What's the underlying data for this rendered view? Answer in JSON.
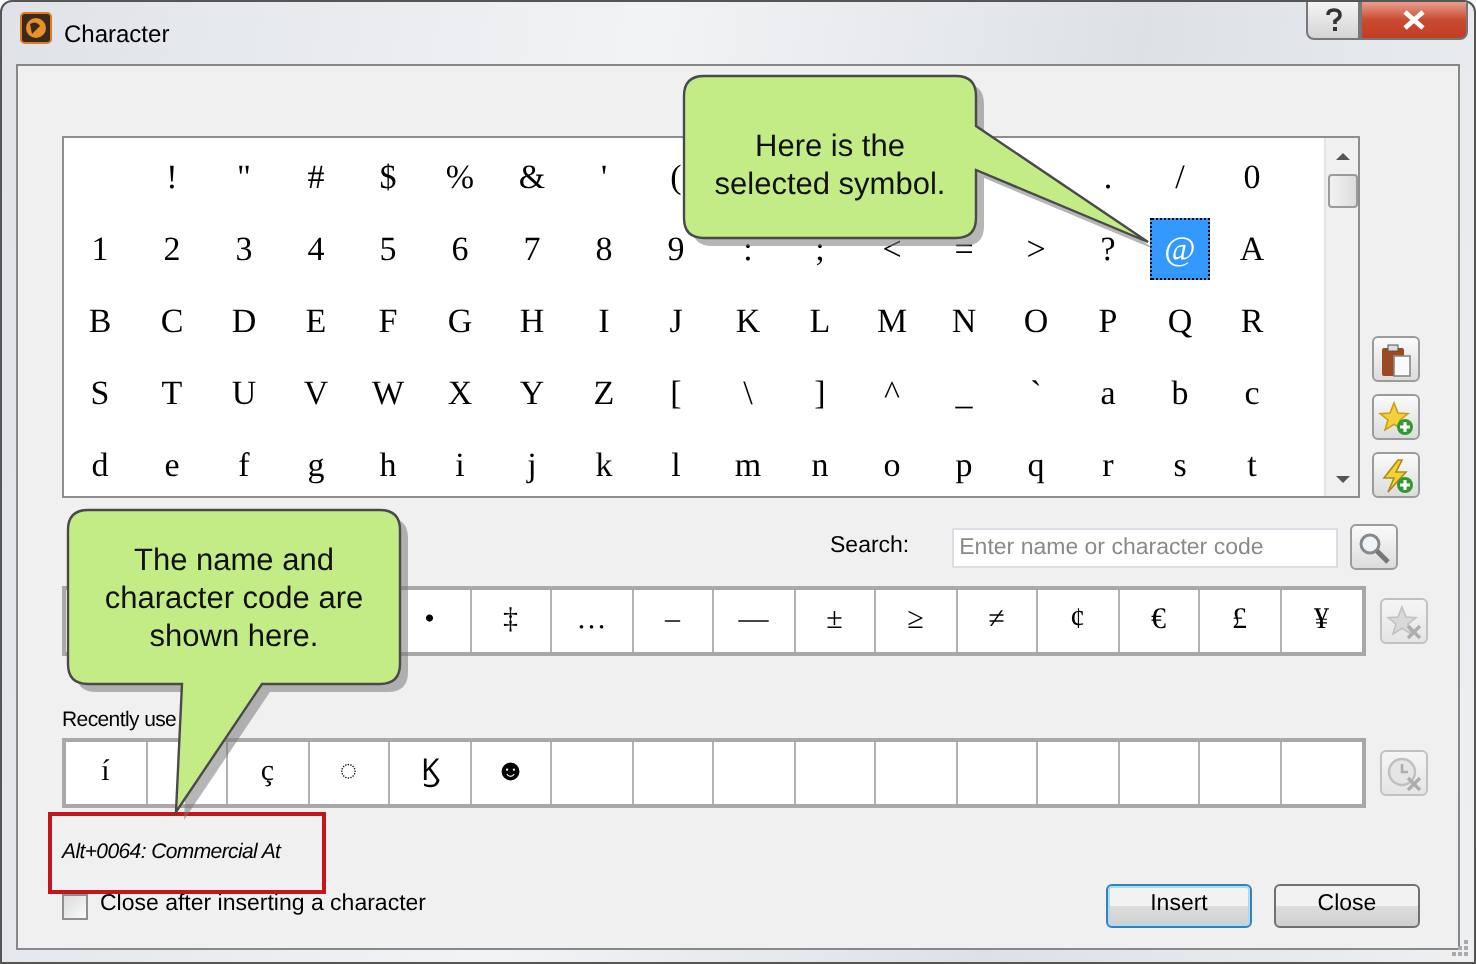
{
  "window": {
    "title": "Character"
  },
  "character_grid": {
    "rows": [
      [
        {
          "selected": false
        },
        {
          "char": "!",
          "selected": false
        },
        {
          "char": "\"",
          "selected": false
        },
        {
          "char": "#",
          "selected": false
        },
        {
          "char": "$",
          "selected": false
        },
        {
          "char": "%",
          "selected": false
        },
        {
          "char": "&",
          "selected": false
        },
        {
          "char": "'",
          "selected": false
        },
        {
          "char": "(",
          "selected": false
        },
        null,
        null,
        null,
        null,
        null,
        {
          "char": ".",
          "selected": false
        },
        {
          "char": "/",
          "selected": false
        },
        {
          "char": "0",
          "selected": false
        }
      ],
      [
        {
          "char": "1",
          "selected": false
        },
        {
          "char": "2",
          "selected": false
        },
        {
          "char": "3",
          "selected": false
        },
        {
          "char": "4",
          "selected": false
        },
        {
          "char": "5",
          "selected": false
        },
        {
          "char": "6",
          "selected": false
        },
        {
          "char": "7",
          "selected": false
        },
        {
          "char": "8",
          "selected": false
        },
        {
          "char": "9",
          "selected": false
        },
        {
          "char": ":",
          "selected": false
        },
        {
          "char": ";",
          "selected": false
        },
        {
          "char": "<",
          "selected": false
        },
        {
          "char": "=",
          "selected": false
        },
        {
          "char": ">",
          "selected": false
        },
        {
          "char": "?",
          "selected": false
        },
        {
          "char": "@",
          "selected": true
        },
        {
          "char": "A",
          "selected": false
        }
      ],
      [
        {
          "char": "B",
          "selected": false
        },
        {
          "char": "C",
          "selected": false
        },
        {
          "char": "D",
          "selected": false
        },
        {
          "char": "E",
          "selected": false
        },
        {
          "char": "F",
          "selected": false
        },
        {
          "char": "G",
          "selected": false
        },
        {
          "char": "H",
          "selected": false
        },
        {
          "char": "I",
          "selected": false
        },
        {
          "char": "J",
          "selected": false
        },
        {
          "char": "K",
          "selected": false
        },
        {
          "char": "L",
          "selected": false
        },
        {
          "char": "M",
          "selected": false
        },
        {
          "char": "N",
          "selected": false
        },
        {
          "char": "O",
          "selected": false
        },
        {
          "char": "P",
          "selected": false
        },
        {
          "char": "Q",
          "selected": false
        },
        {
          "char": "R",
          "selected": false
        }
      ],
      [
        {
          "char": "S",
          "selected": false
        },
        {
          "char": "T",
          "selected": false
        },
        {
          "char": "U",
          "selected": false
        },
        {
          "char": "V",
          "selected": false
        },
        {
          "char": "W",
          "selected": false
        },
        {
          "char": "X",
          "selected": false
        },
        {
          "char": "Y",
          "selected": false
        },
        {
          "char": "Z",
          "selected": false
        },
        {
          "char": "[",
          "selected": false
        },
        {
          "char": "\\",
          "selected": false
        },
        {
          "char": "]",
          "selected": false
        },
        {
          "char": "^",
          "selected": false
        },
        {
          "char": "_",
          "selected": false
        },
        {
          "char": "`",
          "selected": false
        },
        {
          "char": "a",
          "selected": false
        },
        {
          "char": "b",
          "selected": false
        },
        {
          "char": "c",
          "selected": false
        }
      ],
      [
        {
          "char": "d",
          "selected": false
        },
        {
          "char": "e",
          "selected": false
        },
        {
          "char": "f",
          "selected": false
        },
        {
          "char": "g",
          "selected": false
        },
        {
          "char": "h",
          "selected": false
        },
        {
          "char": "i",
          "selected": false
        },
        {
          "char": "j",
          "selected": false
        },
        {
          "char": "k",
          "selected": false
        },
        {
          "char": "l",
          "selected": false
        },
        {
          "char": "m",
          "selected": false
        },
        {
          "char": "n",
          "selected": false
        },
        {
          "char": "o",
          "selected": false
        },
        {
          "char": "p",
          "selected": false
        },
        {
          "char": "q",
          "selected": false
        },
        {
          "char": "r",
          "selected": false
        },
        {
          "char": "s",
          "selected": false
        },
        {
          "char": "t",
          "selected": false
        }
      ]
    ]
  },
  "search": {
    "label": "Search:",
    "placeholder": "Enter name or character code"
  },
  "favorites": {
    "cells": [
      null,
      null,
      null,
      null,
      "•",
      "‡",
      "…",
      "–",
      "—",
      "±",
      "≥",
      "≠",
      "¢",
      "€",
      "£",
      "¥"
    ]
  },
  "recently_used": {
    "label": "Recently use",
    "cells": [
      "í",
      null,
      "ç",
      "◌",
      "Ϗ",
      "☻",
      null,
      null,
      null,
      null,
      null,
      null,
      null,
      null,
      null,
      null
    ]
  },
  "status": {
    "text": "Alt+0064: Commercial At",
    "highlighted": true
  },
  "close_after_insert": {
    "label": "Close after inserting a character",
    "checked": false
  },
  "buttons": [
    {
      "label": "Insert",
      "focused": true
    },
    {
      "label": "Close",
      "focused": false
    }
  ],
  "callouts": [
    {
      "kind": "pointer-right",
      "text": "Here is the selected symbol."
    },
    {
      "kind": "pointer-down",
      "text": "The name and character code are shown here."
    }
  ]
}
